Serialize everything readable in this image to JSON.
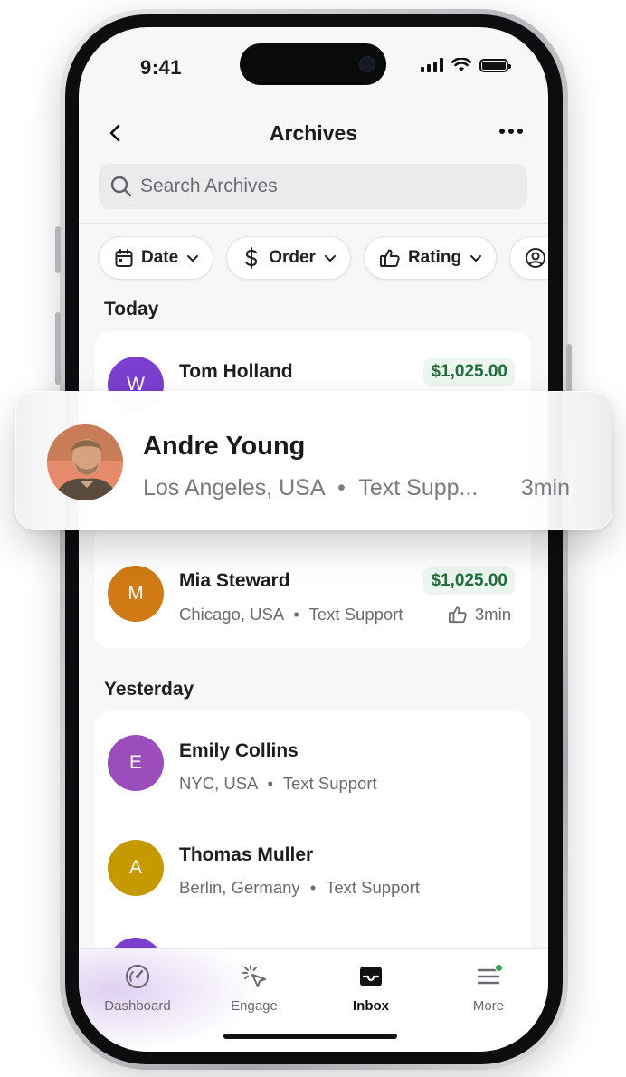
{
  "status": {
    "time": "9:41"
  },
  "nav": {
    "title": "Archives"
  },
  "search": {
    "placeholder": "Search Archives"
  },
  "filters": [
    {
      "label": "Date",
      "icon": "calendar-icon"
    },
    {
      "label": "Order",
      "icon": "dollar-icon"
    },
    {
      "label": "Rating",
      "icon": "thumbs-up-icon"
    }
  ],
  "sections": {
    "today": "Today",
    "yesterday": "Yesterday"
  },
  "today": [
    {
      "name": "Tom Holland",
      "initial": "W",
      "amount": "$1,025.00",
      "color": "#7b3fd0"
    },
    {
      "name": "Mia Steward",
      "initial": "M",
      "location": "Chicago, USA",
      "channel": "Text Support",
      "time": "3min",
      "amount": "$1,025.00",
      "color": "#cf7a14"
    }
  ],
  "yesterday": [
    {
      "name": "Emily Collins",
      "initial": "E",
      "location": "NYC, USA",
      "channel": "Text Support",
      "color": "#9b4dbb"
    },
    {
      "name": "Thomas Muller",
      "initial": "A",
      "location": "Berlin, Germany",
      "channel": "Text Support",
      "color": "#c49a00"
    }
  ],
  "floating_card": {
    "name": "Andre Young",
    "location": "Los Angeles, USA",
    "channel": "Text Supp...",
    "time": "3min"
  },
  "separator": "•",
  "tabs": [
    {
      "label": "Dashboard",
      "icon": "speedometer-icon"
    },
    {
      "label": "Engage",
      "icon": "cursor-click-icon"
    },
    {
      "label": "Inbox",
      "icon": "inbox-icon",
      "active": true
    },
    {
      "label": "More",
      "icon": "menu-icon",
      "badge_color": "#2fa84f"
    }
  ],
  "colors": {
    "amount_bg": "#ecf6ef",
    "amount_text": "#1f6e3a",
    "screen_bg": "#f7f7f8"
  }
}
